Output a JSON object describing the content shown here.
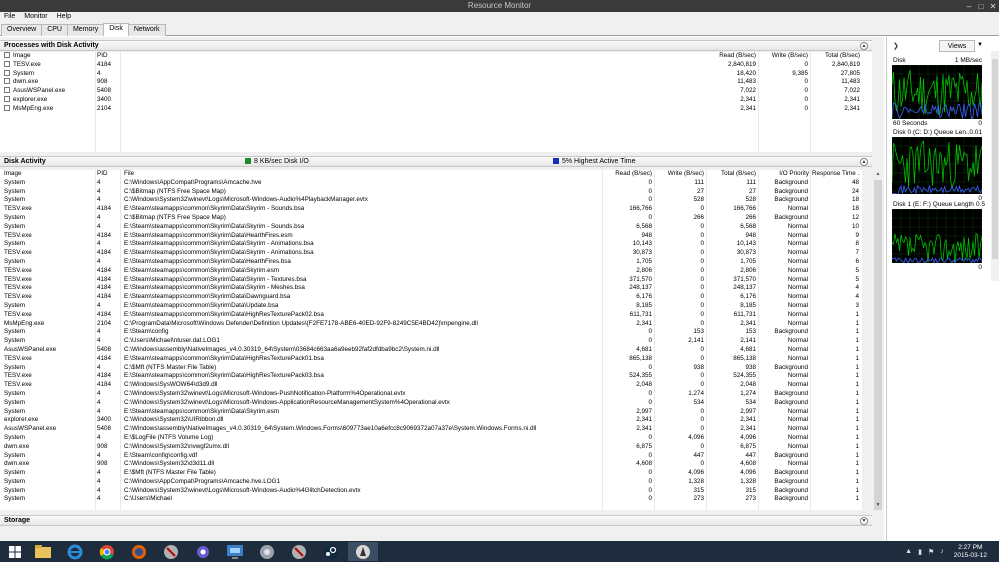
{
  "window": {
    "title": "Resource Monitor"
  },
  "menu": [
    "File",
    "Monitor",
    "Help"
  ],
  "tabs": [
    {
      "label": "Overview",
      "active": false
    },
    {
      "label": "CPU",
      "active": false
    },
    {
      "label": "Memory",
      "active": false
    },
    {
      "label": "Disk",
      "active": true
    },
    {
      "label": "Network",
      "active": false
    }
  ],
  "processes": {
    "title": "Processes with Disk Activity",
    "columns": [
      "Image",
      "PID",
      "Read (B/sec)",
      "Write (B/sec)",
      "Total (B/sec)"
    ],
    "rows": [
      [
        "TESV.exe",
        "4184",
        "2,840,819",
        "0",
        "2,840,819"
      ],
      [
        "System",
        "4",
        "18,420",
        "9,385",
        "27,805"
      ],
      [
        "dwm.exe",
        "908",
        "11,483",
        "0",
        "11,483"
      ],
      [
        "AsusWSPanel.exe",
        "5408",
        "7,022",
        "0",
        "7,022"
      ],
      [
        "explorer.exe",
        "3400",
        "2,341",
        "0",
        "2,341"
      ],
      [
        "MsMpEng.exe",
        "2104",
        "2,341",
        "0",
        "2,341"
      ]
    ]
  },
  "disk_activity": {
    "title": "Disk Activity",
    "legend_io": "8 KB/sec Disk I/O",
    "legend_active": "5% Highest Active Time",
    "columns": [
      "Image",
      "PID",
      "File",
      "Read (B/sec)",
      "Write (B/sec)",
      "Total (B/sec)",
      "I/O Priority",
      "Response Time ..."
    ],
    "rows": [
      [
        "System",
        "4",
        "C:\\Windows\\AppCompat\\Programs\\Amcache.hve",
        "0",
        "111",
        "111",
        "Background",
        "48"
      ],
      [
        "System",
        "4",
        "C:\\$Bitmap (NTFS Free Space Map)",
        "0",
        "27",
        "27",
        "Background",
        "24"
      ],
      [
        "System",
        "4",
        "C:\\Windows\\System32\\winevt\\Logs\\Microsoft-Windows-Audio%4PlaybackManager.evtx",
        "0",
        "528",
        "528",
        "Background",
        "18"
      ],
      [
        "TESV.exe",
        "4184",
        "E:\\Steam\\steamapps\\common\\Skyrim\\Data\\Skyrim - Sounds.bsa",
        "166,766",
        "0",
        "166,766",
        "Normal",
        "18"
      ],
      [
        "System",
        "4",
        "C:\\$Bitmap (NTFS Free Space Map)",
        "0",
        "266",
        "266",
        "Background",
        "12"
      ],
      [
        "System",
        "4",
        "E:\\Steam\\steamapps\\common\\Skyrim\\Data\\Skyrim - Sounds.bsa",
        "6,568",
        "0",
        "6,568",
        "Normal",
        "10"
      ],
      [
        "TESV.exe",
        "4184",
        "E:\\Steam\\steamapps\\common\\Skyrim\\Data\\HearthFires.esm",
        "948",
        "0",
        "948",
        "Normal",
        "9"
      ],
      [
        "System",
        "4",
        "E:\\Steam\\steamapps\\common\\Skyrim\\Data\\Skyrim - Animations.bsa",
        "10,143",
        "0",
        "10,143",
        "Normal",
        "8"
      ],
      [
        "TESV.exe",
        "4184",
        "E:\\Steam\\steamapps\\common\\Skyrim\\Data\\Skyrim - Animations.bsa",
        "30,873",
        "0",
        "30,873",
        "Normal",
        "7"
      ],
      [
        "System",
        "4",
        "E:\\Steam\\steamapps\\common\\Skyrim\\Data\\HearthFires.bsa",
        "1,705",
        "0",
        "1,705",
        "Normal",
        "6"
      ],
      [
        "TESV.exe",
        "4184",
        "E:\\Steam\\steamapps\\common\\Skyrim\\Data\\Skyrim.esm",
        "2,806",
        "0",
        "2,806",
        "Normal",
        "5"
      ],
      [
        "TESV.exe",
        "4184",
        "E:\\Steam\\steamapps\\common\\Skyrim\\Data\\Skyrim - Textures.bsa",
        "371,570",
        "0",
        "371,570",
        "Normal",
        "5"
      ],
      [
        "TESV.exe",
        "4184",
        "E:\\Steam\\steamapps\\common\\Skyrim\\Data\\Skyrim - Meshes.bsa",
        "248,137",
        "0",
        "248,137",
        "Normal",
        "4"
      ],
      [
        "TESV.exe",
        "4184",
        "E:\\Steam\\steamapps\\common\\Skyrim\\Data\\Dawnguard.bsa",
        "6,176",
        "0",
        "6,176",
        "Normal",
        "4"
      ],
      [
        "System",
        "4",
        "E:\\Steam\\steamapps\\common\\Skyrim\\Data\\Update.bsa",
        "8,185",
        "0",
        "8,185",
        "Normal",
        "3"
      ],
      [
        "TESV.exe",
        "4184",
        "E:\\Steam\\steamapps\\common\\Skyrim\\Data\\HighResTexturePack02.bsa",
        "611,731",
        "0",
        "611,731",
        "Normal",
        "1"
      ],
      [
        "MsMpEng.exe",
        "2104",
        "C:\\ProgramData\\Microsoft\\Windows Defender\\Definition Updates\\{F2FE7178-ABE6-40ED-92F9-8249C5E4BD42}\\mpengine.dll",
        "2,341",
        "0",
        "2,341",
        "Normal",
        "1"
      ],
      [
        "System",
        "4",
        "E:\\Steam\\config",
        "0",
        "153",
        "153",
        "Background",
        "1"
      ],
      [
        "System",
        "4",
        "C:\\Users\\Michael\\ntuser.dat.LOG1",
        "0",
        "2,141",
        "2,141",
        "Normal",
        "1"
      ],
      [
        "AsusWSPanel.exe",
        "5408",
        "C:\\Windows\\assembly\\NativeImages_v4.0.30319_64\\System\\03684c663aa6a9eeb92faf2dfdba9bc2\\System.ni.dll",
        "4,681",
        "0",
        "4,681",
        "Normal",
        "1"
      ],
      [
        "TESV.exe",
        "4184",
        "E:\\Steam\\steamapps\\common\\Skyrim\\Data\\HighResTexturePack01.bsa",
        "865,138",
        "0",
        "865,138",
        "Normal",
        "1"
      ],
      [
        "System",
        "4",
        "C:\\$Mft (NTFS Master File Table)",
        "0",
        "938",
        "938",
        "Background",
        "1"
      ],
      [
        "TESV.exe",
        "4184",
        "E:\\Steam\\steamapps\\common\\Skyrim\\Data\\HighResTexturePack03.bsa",
        "524,355",
        "0",
        "524,355",
        "Normal",
        "1"
      ],
      [
        "TESV.exe",
        "4184",
        "C:\\Windows\\SysWOW64\\d3d9.dll",
        "2,048",
        "0",
        "2,048",
        "Normal",
        "1"
      ],
      [
        "System",
        "4",
        "C:\\Windows\\System32\\winevt\\Logs\\Microsoft-Windows-PushNotification-Platform%4Operational.evtx",
        "0",
        "1,274",
        "1,274",
        "Background",
        "1"
      ],
      [
        "System",
        "4",
        "C:\\Windows\\System32\\winevt\\Logs\\Microsoft-Windows-ApplicationResourceManagementSystem%4Operational.evtx",
        "0",
        "534",
        "534",
        "Background",
        "1"
      ],
      [
        "System",
        "4",
        "E:\\Steam\\steamapps\\common\\Skyrim\\Data\\Skyrim.esm",
        "2,997",
        "0",
        "2,997",
        "Normal",
        "1"
      ],
      [
        "explorer.exe",
        "3400",
        "C:\\Windows\\System32\\UIRibbon.dll",
        "2,341",
        "0",
        "2,341",
        "Normal",
        "1"
      ],
      [
        "AsusWSPanel.exe",
        "5408",
        "C:\\Windows\\assembly\\NativeImages_v4.0.30319_64\\System.Windows.Forms\\609773ae10a6efcc8c9069372a07a37e\\System.Windows.Forms.ni.dll",
        "2,341",
        "0",
        "2,341",
        "Normal",
        "1"
      ],
      [
        "System",
        "4",
        "E:\\$LogFile (NTFS Volume Log)",
        "0",
        "4,096",
        "4,096",
        "Normal",
        "1"
      ],
      [
        "dwm.exe",
        "908",
        "C:\\Windows\\System32\\nvwgf2umx.dll",
        "6,875",
        "0",
        "6,875",
        "Normal",
        "1"
      ],
      [
        "System",
        "4",
        "E:\\Steam\\config\\config.vdf",
        "0",
        "447",
        "447",
        "Background",
        "1"
      ],
      [
        "dwm.exe",
        "908",
        "C:\\Windows\\System32\\d3d11.dll",
        "4,608",
        "0",
        "4,608",
        "Normal",
        "1"
      ],
      [
        "System",
        "4",
        "E:\\$Mft (NTFS Master File Table)",
        "0",
        "4,096",
        "4,096",
        "Background",
        "1"
      ],
      [
        "System",
        "4",
        "C:\\Windows\\AppCompat\\Programs\\Amcache.hve.LOG1",
        "0",
        "1,328",
        "1,328",
        "Background",
        "1"
      ],
      [
        "System",
        "4",
        "C:\\Windows\\System32\\winevt\\Logs\\Microsoft-Windows-Audio%4GlitchDetection.evtx",
        "0",
        "315",
        "315",
        "Background",
        "1"
      ],
      [
        "System",
        "4",
        "C:\\Users\\Michael",
        "0",
        "273",
        "273",
        "Background",
        "1"
      ]
    ]
  },
  "storage": {
    "title": "Storage"
  },
  "right_panel": {
    "views_label": "Views",
    "graphs": [
      {
        "title": "Disk",
        "scale": "1 MB/sec",
        "footer_left": "60 Seconds",
        "footer_right": "0"
      },
      {
        "title": "Disk 0 (C: D:) Queue Len...",
        "scale": "0.01",
        "footer_left": "",
        "footer_right": "0"
      },
      {
        "title": "Disk 1 (E: F:) Queue Length",
        "scale": "0.5",
        "footer_left": "",
        "footer_right": "0"
      }
    ]
  },
  "taskbar": {
    "apps": [
      "start-icon",
      "file-explorer-icon",
      "internet-explorer-icon",
      "chrome-icon",
      "firefox-icon",
      "app-icon-1",
      "settings-gear-icon",
      "control-panel-icon",
      "app-icon-2",
      "app-icon-3",
      "steam-icon",
      "app-icon-4"
    ],
    "time": "2:27 PM",
    "date": "2015-03-12"
  },
  "colors": {
    "io_green": "#1f8a2a",
    "active_blue": "#1530b8",
    "graph_green": "#00c000",
    "graph_blue": "#3a5fff",
    "taskbar": "#1f2c3d"
  }
}
